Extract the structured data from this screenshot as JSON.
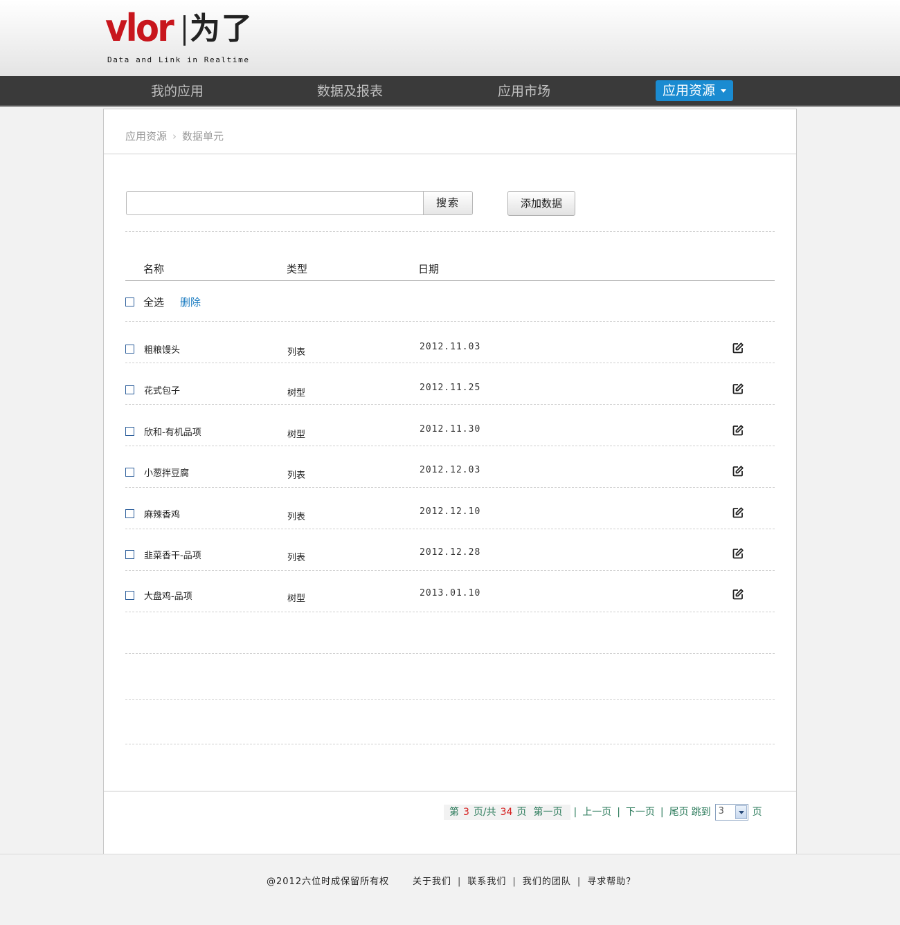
{
  "logo": {
    "brand": "vlor",
    "brand_cn": "为了",
    "tagline": "Data and Link in Realtime"
  },
  "nav": {
    "items": [
      {
        "label": "我的应用"
      },
      {
        "label": "数据及报表"
      },
      {
        "label": "应用市场"
      },
      {
        "label": "应用资源",
        "active": true
      }
    ]
  },
  "breadcrumb": {
    "parent": "应用资源",
    "current": "数据单元"
  },
  "toolbar": {
    "search_value": "",
    "search_label": "搜索",
    "add_label": "添加数据"
  },
  "table": {
    "columns": [
      "名称",
      "类型",
      "日期"
    ],
    "select_all_label": "全选",
    "delete_label": "删除",
    "rows": [
      {
        "name": "粗粮馒头",
        "type": "列表",
        "date": "2012.11.03"
      },
      {
        "name": "花式包子",
        "type": "树型",
        "date": "2012.11.25"
      },
      {
        "name": "欣和-有机品项",
        "type": "树型",
        "date": "2012.11.30"
      },
      {
        "name": "小葱拌豆腐",
        "type": "列表",
        "date": "2012.12.03"
      },
      {
        "name": "麻辣香鸡",
        "type": "列表",
        "date": "2012.12.10"
      },
      {
        "name": "韭菜香干-品项",
        "type": "列表",
        "date": "2012.12.28"
      },
      {
        "name": "大盘鸡-品项",
        "type": "树型",
        "date": "2013.01.10"
      }
    ]
  },
  "pager": {
    "prefix": "第",
    "current": "3",
    "mid": "页/共",
    "total": "34",
    "suffix": "页",
    "first": "第一页",
    "prev": "上一页",
    "next": "下一页",
    "last": "尾页",
    "jump_label": "跳到",
    "jump_value": "3",
    "jump_suffix": "页"
  },
  "footer": {
    "copyright": "@2012六位时成保留所有权",
    "links": [
      "关于我们",
      "联系我们",
      "我们的团队",
      "寻求帮助？"
    ]
  },
  "colors": {
    "accent": "#1a8bd1",
    "brand_red": "#c8161d",
    "nav_bg": "#3a3a3a",
    "pager_green": "#2a7a5a",
    "pager_num": "#d62020"
  }
}
